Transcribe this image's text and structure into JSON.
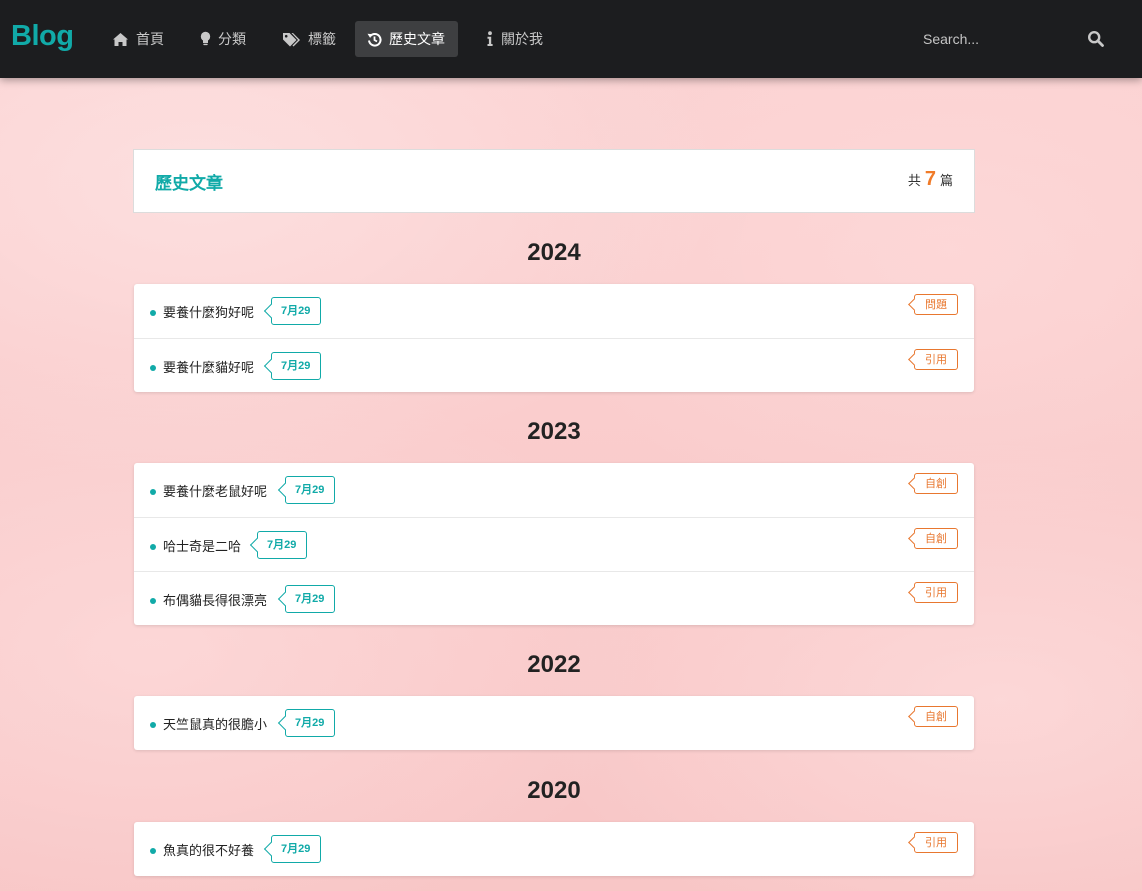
{
  "navbar": {
    "brand": "Blog",
    "items": [
      {
        "label": "首頁",
        "icon": "home-icon"
      },
      {
        "label": "分類",
        "icon": "lightbulb-icon"
      },
      {
        "label": "標籤",
        "icon": "tags-icon"
      },
      {
        "label": "歷史文章",
        "icon": "history-icon",
        "active": true
      },
      {
        "label": "關於我",
        "icon": "info-icon"
      }
    ],
    "search": {
      "placeholder": "Search...",
      "icon": "search-icon"
    }
  },
  "archive": {
    "title": "歷史文章",
    "count_prefix": "共",
    "count": "7",
    "count_suffix": "篇"
  },
  "groups": [
    {
      "year": "2024",
      "posts": [
        {
          "title": "要養什麼狗好呢",
          "date": "7月29",
          "category": "問題"
        },
        {
          "title": "要養什麼貓好呢",
          "date": "7月29",
          "category": "引用"
        }
      ]
    },
    {
      "year": "2023",
      "posts": [
        {
          "title": "要養什麼老鼠好呢",
          "date": "7月29",
          "category": "自創"
        },
        {
          "title": "哈士奇是二哈",
          "date": "7月29",
          "category": "自創"
        },
        {
          "title": "布偶貓長得很漂亮",
          "date": "7月29",
          "category": "引用"
        }
      ]
    },
    {
      "year": "2022",
      "posts": [
        {
          "title": "天竺鼠真的很膽小",
          "date": "7月29",
          "category": "自創"
        }
      ]
    },
    {
      "year": "2020",
      "posts": [
        {
          "title": "魚真的很不好養",
          "date": "7月29",
          "category": "引用"
        }
      ]
    }
  ],
  "colors": {
    "accent": "#11aaa8",
    "category": "#e8772f",
    "count": "#f07b29",
    "navbar": "#1c1d1f"
  }
}
